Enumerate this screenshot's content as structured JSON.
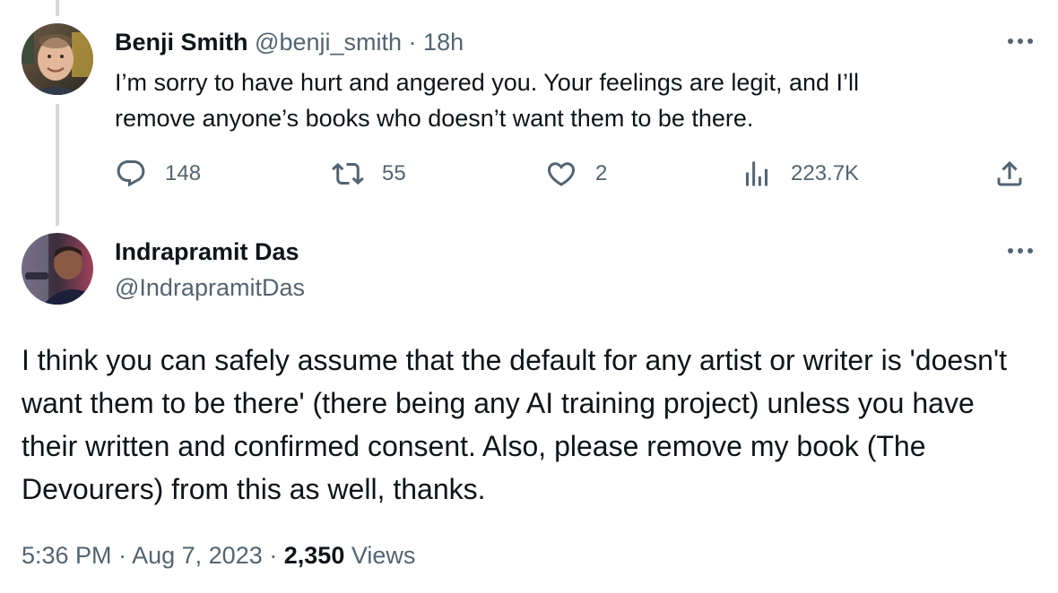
{
  "parent_tweet": {
    "display_name": "Benji Smith",
    "handle": "@benji_smith",
    "separator": "·",
    "time_ago": "18h",
    "text_line1": "I’m sorry to have hurt and angered you. Your feelings are legit, and I’ll",
    "text_line2": "remove anyone’s books  who doesn’t want them to be there.",
    "replies": "148",
    "retweets": "55",
    "likes": "2",
    "views": "223.7K",
    "icons": [
      "reply-icon",
      "retweet-icon",
      "like-icon",
      "views-icon",
      "share-icon",
      "more-icon"
    ]
  },
  "main_tweet": {
    "display_name": "Indrapramit Das",
    "handle": "@IndrapramitDas",
    "text": "I think you can safely assume that the default for any artist or writer is 'doesn't want them to be there' (there being any AI training project) unless you have their written and confirmed consent. Also, please remove my book (The Devourers) from this as well, thanks.",
    "time": "5:36 PM",
    "separator": "·",
    "date": "Aug 7, 2023",
    "views_count": "2,350",
    "views_label": "Views"
  },
  "colors": {
    "text_primary": "#0f1419",
    "text_secondary": "#536471",
    "thread_line": "#cfd9de",
    "background": "#ffffff"
  }
}
